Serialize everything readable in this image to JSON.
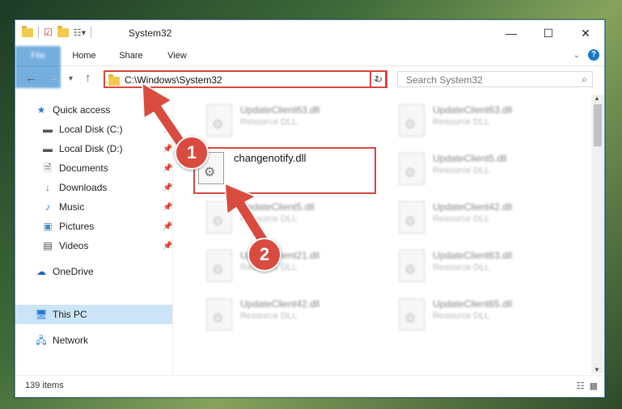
{
  "window": {
    "title": "System32"
  },
  "ribbon": {
    "tabs": [
      "File",
      "Home",
      "Share",
      "View"
    ]
  },
  "nav": {
    "address": "C:\\Windows\\System32",
    "search_placeholder": "Search System32"
  },
  "sidebar": {
    "items": [
      {
        "label": "Quick access",
        "icon": "star-icon"
      },
      {
        "label": "Local Disk (C:)",
        "icon": "drive-icon",
        "pinned": true
      },
      {
        "label": "Local Disk (D:)",
        "icon": "drive-icon",
        "pinned": true
      },
      {
        "label": "Documents",
        "icon": "documents-icon",
        "pinned": true
      },
      {
        "label": "Downloads",
        "icon": "download-icon",
        "pinned": true
      },
      {
        "label": "Music",
        "icon": "music-icon",
        "pinned": true
      },
      {
        "label": "Pictures",
        "icon": "pictures-icon",
        "pinned": true
      },
      {
        "label": "Videos",
        "icon": "videos-icon",
        "pinned": true
      },
      {
        "label": "OneDrive",
        "icon": "cloud-icon"
      },
      {
        "label": "This PC",
        "icon": "computer-icon",
        "selected": true
      },
      {
        "label": "Network",
        "icon": "network-icon"
      }
    ]
  },
  "files": [
    {
      "name": "UpdateClient63.dll",
      "type": "Resource DLL"
    },
    {
      "name": "UpdateClient63.dll",
      "type": "Resource DLL"
    },
    {
      "name": "UpdateClient5.dll",
      "type": "Resource DLL"
    },
    {
      "name": "UpdateClient5.dll",
      "type": "Resource DLL"
    },
    {
      "name": "UpdateClient42.dll",
      "type": "Resource DLL"
    },
    {
      "name": "UpdateClient21.dll",
      "type": "Resource DLL"
    },
    {
      "name": "UpdateClient63.dll",
      "type": "Resource DLL"
    },
    {
      "name": "UpdateClient42.dll",
      "type": "Resource DLL"
    },
    {
      "name": "UpdateClient65.dll",
      "type": "Resource DLL"
    }
  ],
  "highlighted_file": {
    "name": "changenotify.dll"
  },
  "callouts": {
    "one": "1",
    "two": "2"
  },
  "status": {
    "count": "139 items"
  },
  "colors": {
    "accent": "#1979ca",
    "highlight": "#d9473f"
  }
}
